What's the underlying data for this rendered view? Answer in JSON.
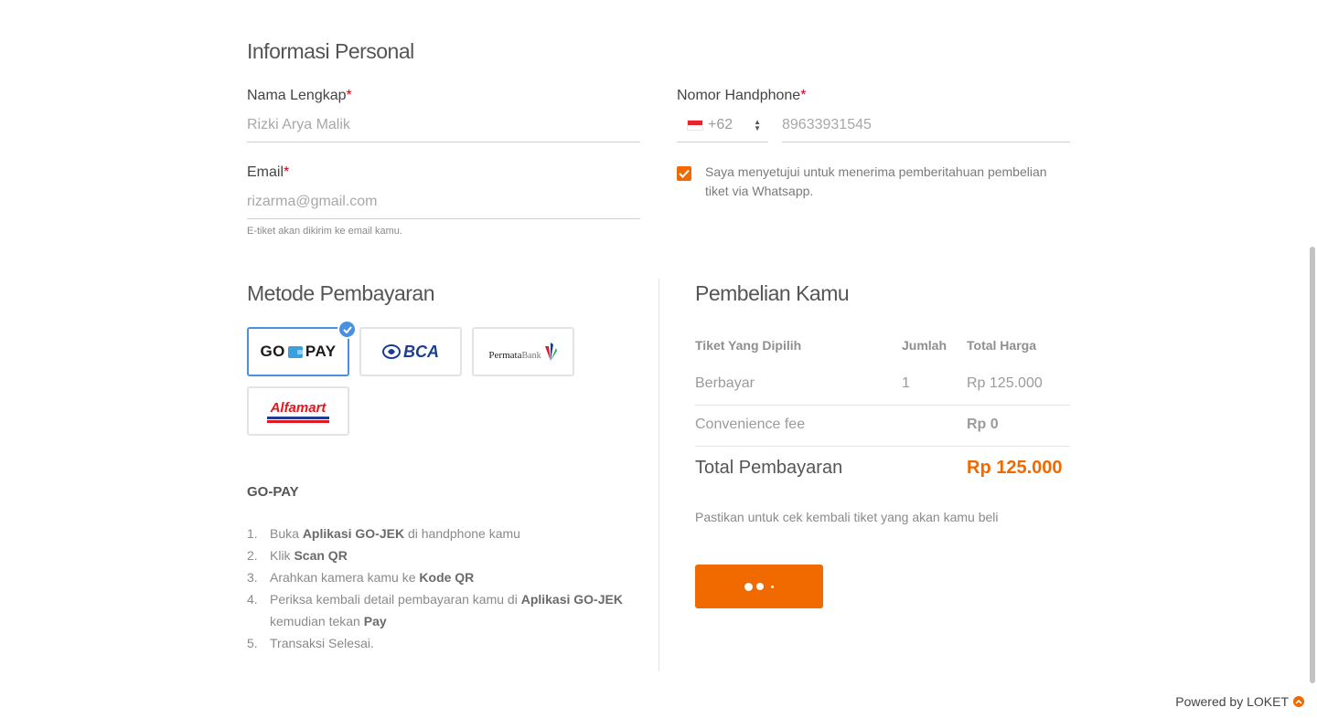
{
  "personal": {
    "title": "Informasi Personal",
    "name_label": "Nama Lengkap",
    "name_placeholder": "Rizki Arya Malik",
    "email_label": "Email",
    "email_placeholder": "rizarma@gmail.com",
    "email_hint": "E-tiket akan dikirim ke email kamu.",
    "phone_label": "Nomor Handphone",
    "country_code": "+62",
    "phone_placeholder": "89633931545",
    "required_mark": "*",
    "consent_text": "Saya menyetujui untuk menerima pemberitahuan pembelian tiket via Whatsapp.",
    "consent_checked": true
  },
  "payment": {
    "title": "Metode Pembayaran",
    "methods": [
      {
        "name": "GO-PAY",
        "logo_text_1": "GO",
        "logo_text_2": "PAY",
        "selected": true,
        "icon": "gopay-logo"
      },
      {
        "name": "BCA",
        "logo_text": "BCA",
        "selected": false,
        "icon": "bca-logo"
      },
      {
        "name": "PermataBank",
        "logo_text_1": "Permata",
        "logo_text_2": "Bank",
        "selected": false,
        "icon": "permatabank-logo"
      },
      {
        "name": "Alfamart",
        "logo_text": "Alfamart",
        "selected": false,
        "icon": "alfamart-logo"
      }
    ],
    "selected_heading": "GO-PAY",
    "steps": [
      {
        "num": "1.",
        "parts": [
          "Buka ",
          "Aplikasi GO-JEK",
          " di handphone kamu"
        ]
      },
      {
        "num": "2.",
        "parts": [
          "Klik ",
          "Scan QR",
          ""
        ]
      },
      {
        "num": "3.",
        "parts": [
          "Arahkan kamera kamu ke ",
          "Kode QR",
          ""
        ]
      },
      {
        "num": "4.",
        "parts": [
          "Periksa kembali detail pembayaran kamu di ",
          "Aplikasi GO-JEK",
          " kemudian tekan ",
          "Pay"
        ]
      },
      {
        "num": "5.",
        "parts": [
          "Transaksi Selesai.",
          "",
          ""
        ]
      }
    ]
  },
  "summary": {
    "title": "Pembelian Kamu",
    "col_ticket": "Tiket Yang Dipilih",
    "col_qty": "Jumlah",
    "col_total": "Total Harga",
    "ticket_name": "Berbayar",
    "ticket_qty": "1",
    "ticket_price": "Rp 125.000",
    "fee_label": "Convenience fee",
    "fee_value": "Rp 0",
    "total_label": "Total Pembayaran",
    "total_value": "Rp 125.000",
    "note": "Pastikan untuk cek kembali tiket yang akan kamu beli"
  },
  "footer": {
    "powered_by": "Powered by LOKET"
  },
  "colors": {
    "accent": "#f06a00",
    "selected_border": "#4a90e2",
    "required": "#d0021b"
  }
}
